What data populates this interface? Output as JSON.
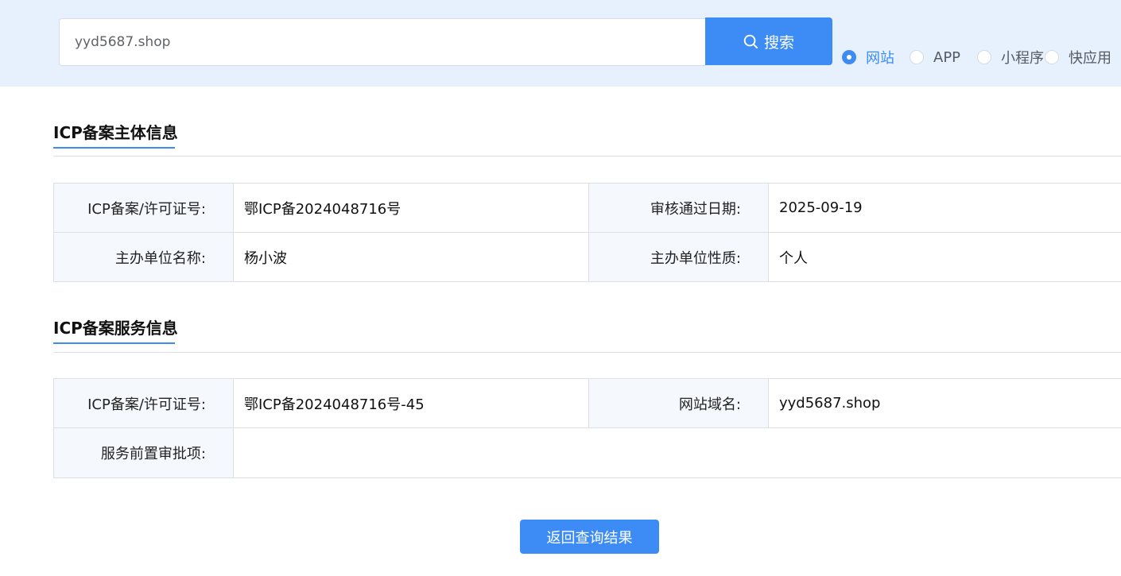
{
  "search": {
    "value": "yyd5687.shop",
    "button_label": "搜索",
    "types": [
      {
        "label": "网站",
        "checked": true
      },
      {
        "label": "APP",
        "checked": false
      },
      {
        "label": "小程序",
        "checked": false
      },
      {
        "label": "快应用",
        "checked": false
      }
    ]
  },
  "subject": {
    "title": "ICP备案主体信息",
    "rows": [
      [
        {
          "key": "ICP备案/许可证号:",
          "value": "鄂ICP备2024048716号"
        },
        {
          "key": "审核通过日期:",
          "value": "2025-09-19"
        }
      ],
      [
        {
          "key": "主办单位名称:",
          "value": "杨小波"
        },
        {
          "key": "主办单位性质:",
          "value": "个人"
        }
      ]
    ]
  },
  "service": {
    "title": "ICP备案服务信息",
    "rows": [
      [
        {
          "key": "ICP备案/许可证号:",
          "value": "鄂ICP备2024048716号-45"
        },
        {
          "key": "网站域名:",
          "value": "yyd5687.shop"
        }
      ],
      [
        {
          "key": "服务前置审批项:",
          "value": ""
        }
      ]
    ]
  },
  "back_button_label": "返回查询结果",
  "colors": {
    "accent": "#3d8cf5",
    "topbar_bg": "#e6f1fd",
    "key_cell_bg": "#f5f8fc"
  }
}
